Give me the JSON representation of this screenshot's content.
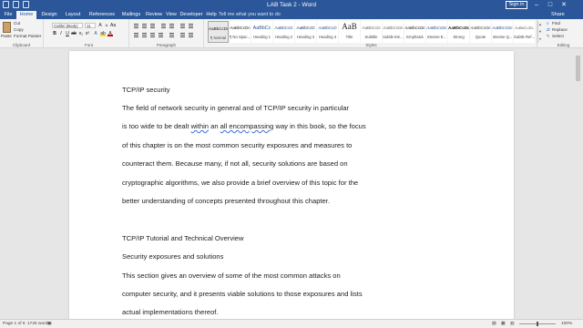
{
  "titlebar": {
    "title": "LAB Task 2 - Word",
    "signin": "Sign in",
    "win_buttons": [
      "–",
      "□",
      "✕"
    ]
  },
  "tabs": [
    "File",
    "Home",
    "Design",
    "Layout",
    "References",
    "Mailings",
    "Review",
    "View",
    "Developer",
    "Help"
  ],
  "active_tab": "Home",
  "tellme": "Tell me what you want to do",
  "share": "Share",
  "ribbon": {
    "clipboard": {
      "paste": "Paste",
      "cut": "Cut",
      "copy": "Copy",
      "format_painter": "Format Painter",
      "label": "Clipboard"
    },
    "font": {
      "font_name": "Calibri (Body)",
      "font_size": "11",
      "label": "Font"
    },
    "paragraph": {
      "label": "Paragraph"
    },
    "styles": {
      "label": "Styles",
      "items": [
        {
          "sample": "AaBbCcDc",
          "name": "¶ Normal"
        },
        {
          "sample": "AaBbCcDc",
          "name": "¶ No Spac..."
        },
        {
          "sample": "AaBbCc",
          "name": "Heading 1"
        },
        {
          "sample": "AaBbCcD",
          "name": "Heading 2"
        },
        {
          "sample": "AaBbCcD",
          "name": "Heading 3"
        },
        {
          "sample": "AaBbCcD",
          "name": "Heading 4"
        },
        {
          "sample": "AaB",
          "name": "Title"
        },
        {
          "sample": "AaBbCcD",
          "name": "Subtitle"
        },
        {
          "sample": "AaBbCcDc",
          "name": "Subtle Em..."
        },
        {
          "sample": "AaBbCcDc",
          "name": "Emphasis"
        },
        {
          "sample": "AaBbCcDc",
          "name": "Intense E..."
        },
        {
          "sample": "AaBbCcDc",
          "name": "Strong"
        },
        {
          "sample": "AaBbCcDc",
          "name": "Quote"
        },
        {
          "sample": "AaBbCcDc",
          "name": "Intense Q..."
        },
        {
          "sample": "AaBbCcDc",
          "name": "Subtle Ref..."
        }
      ]
    },
    "editing": {
      "find": "Find",
      "replace": "Replace",
      "select": "Select",
      "label": "Editing"
    }
  },
  "document": {
    "lines": [
      "TCP/IP security",
      "The field of network security in general and of TCP/IP security in particular",
      "is too wide to be dealt within an all encompassing way in this book, so the focus",
      "of this chapter is on the most common security exposures and measures to",
      "counteract them. Because many, if not all, security solutions are based on",
      "cryptographic algorithms, we also provide a brief overview of this topic for the",
      "better understanding of concepts presented throughout this chapter.",
      "",
      "TCP/IP Tutorial and Technical Overview",
      "Security exposures and solutions",
      "This section gives an overview of some of the most common attacks on",
      "computer security, and it presents viable solutions to those exposures and lists",
      "actual implementations thereof."
    ],
    "line3_parts": [
      "is too wide to be dealt ",
      "within",
      " an ",
      "all encompassing",
      " way in this book, so the focus"
    ]
  },
  "statusbar": {
    "page": "Page 1 of 6",
    "words": "1725 words",
    "zoom": "100%"
  }
}
